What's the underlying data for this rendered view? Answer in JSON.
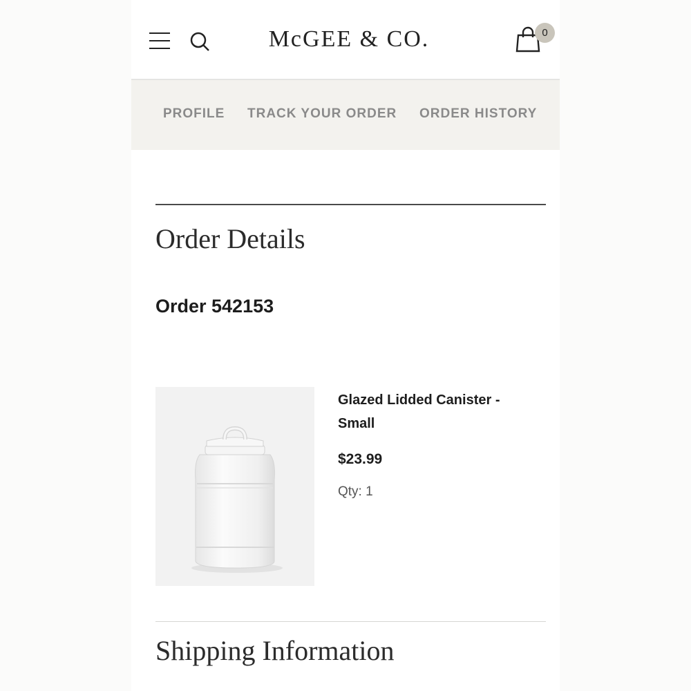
{
  "header": {
    "logo": "McGEE & CO.",
    "cart_count": "0"
  },
  "account_nav": {
    "items": [
      {
        "label": "PROFILE"
      },
      {
        "label": "TRACK YOUR ORDER"
      },
      {
        "label": "ORDER HISTORY"
      }
    ]
  },
  "order_details": {
    "title": "Order Details",
    "order_number": "Order 542153"
  },
  "product": {
    "name": "Glazed Lidded Canister - Small",
    "price": "$23.99",
    "qty_label": "Qty:",
    "qty_value": "1"
  },
  "shipping": {
    "title": "Shipping Information"
  }
}
